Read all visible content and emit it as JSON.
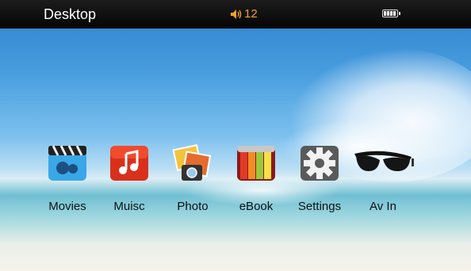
{
  "status_bar": {
    "title": "Desktop",
    "volume": "12",
    "battery_icon": "battery-full-icon"
  },
  "apps": [
    {
      "label": "Movies",
      "icon": "movie-clapper-icon"
    },
    {
      "label": "Muisc",
      "icon": "music-note-icon"
    },
    {
      "label": "Photo",
      "icon": "photo-stack-icon"
    },
    {
      "label": "eBook",
      "icon": "book-spines-icon"
    },
    {
      "label": "Settings",
      "icon": "gear-icon"
    },
    {
      "label": "Av In",
      "icon": "sunglasses-icon"
    }
  ],
  "colors": {
    "status_bar": "#0a0a0a",
    "volume_text": "#f0a030",
    "sky": "#3d92d9"
  }
}
